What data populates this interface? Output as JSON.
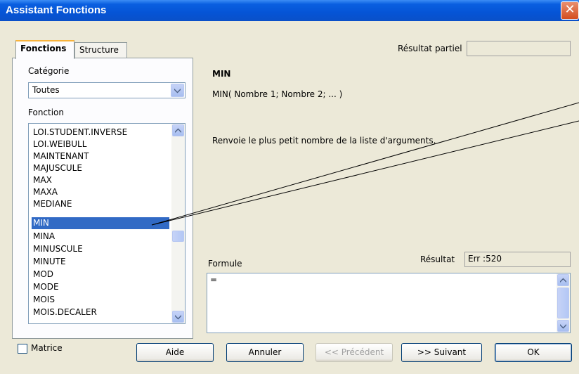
{
  "window": {
    "title": "Assistant Fonctions",
    "close_label": "✕"
  },
  "tabs": [
    {
      "label": "Fonctions"
    },
    {
      "label": "Structure"
    }
  ],
  "category": {
    "label": "Catégorie",
    "value": "Toutes"
  },
  "function": {
    "label": "Fonction",
    "items": [
      "LOI.STUDENT.INVERSE",
      "LOI.WEIBULL",
      "MAINTENANT",
      "MAJUSCULE",
      "MAX",
      "MAXA",
      "MEDIANE",
      "MIN",
      "MINA",
      "MINUSCULE",
      "MINUTE",
      "MOD",
      "MODE",
      "MOIS",
      "MOIS.DECALER"
    ],
    "selected": "MIN"
  },
  "matrix": {
    "label": "Matrice",
    "checked": false
  },
  "partial_result": {
    "label": "Résultat partiel",
    "value": ""
  },
  "info": {
    "name": "MIN",
    "syntax": "MIN( Nombre 1; Nombre 2; ... )",
    "description": "Renvoie le plus petit nombre de la liste d'arguments."
  },
  "formula": {
    "label": "Formule",
    "value": "=",
    "result_label": "Résultat",
    "result_value": "Err :520"
  },
  "buttons": {
    "help": "Aide",
    "cancel": "Annuler",
    "previous": "<< Précédent",
    "next": ">> Suivant",
    "ok": "OK"
  },
  "icons": {
    "close": "close-icon",
    "dropdown": "chevron-down-icon",
    "scroll_up": "chevron-up-icon",
    "scroll_down": "chevron-down-icon"
  },
  "colors": {
    "title_bar": "#0554d6",
    "selection": "#316ac5",
    "tab_accent": "#f8b33c"
  }
}
